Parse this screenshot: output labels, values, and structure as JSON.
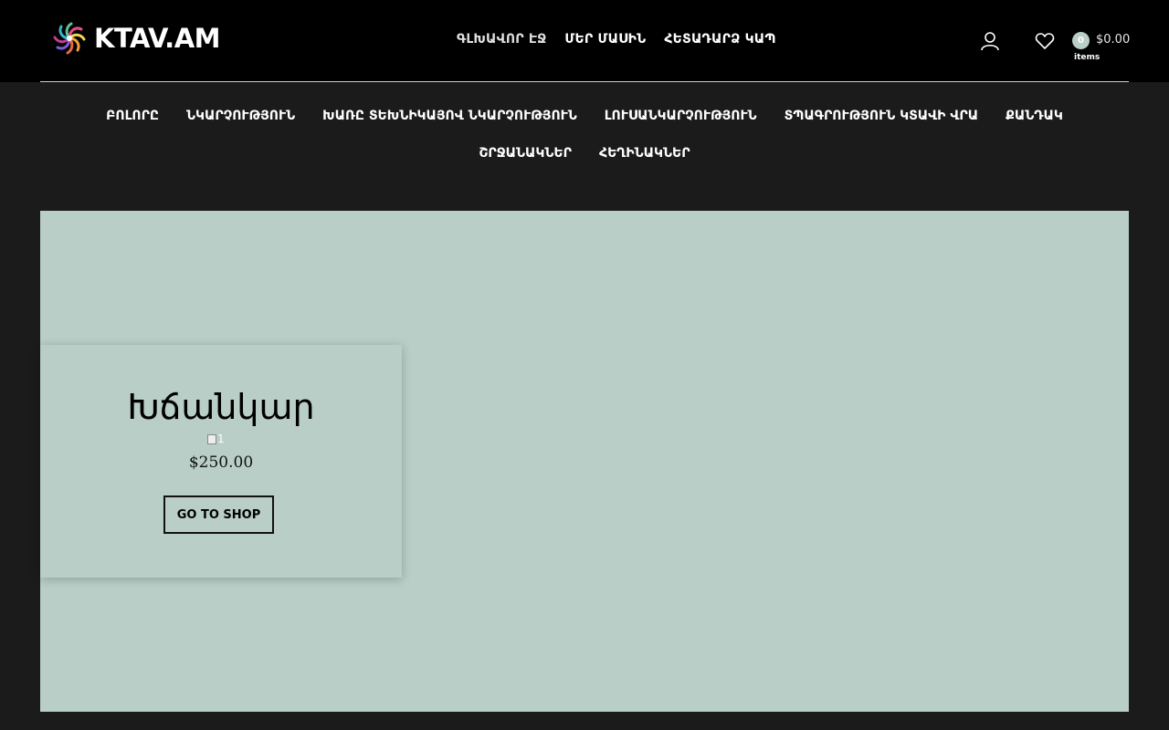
{
  "brand": {
    "name": "KTAV.AM"
  },
  "topnav": {
    "items": [
      {
        "label": "ԳԼԽԱՎՈՐ ԷՋ"
      },
      {
        "label": "ՄԵՐ ՄԱՍԻՆ"
      },
      {
        "label": "ՀԵՏԱԴԱՐՁ ԿԱՊ"
      }
    ]
  },
  "header": {
    "cart_count": "0",
    "cart_total": "$0.00",
    "cart_items_label": "items",
    "badge_color": "#b9cec6"
  },
  "catnav": {
    "items": [
      {
        "label": "ԲՈԼՈՐԸ"
      },
      {
        "label": "ՆԿԱՐՉՈՒԹՅՈՒՆ"
      },
      {
        "label": "ԽԱՌԸ ՏԵԽՆԻԿԱՅՈՎ ՆԿԱՐՉՈՒԹՅՈՒՆ"
      },
      {
        "label": "ԼՈՒՍԱՆԿԱՐՉՈՒԹՅՈՒՆ"
      },
      {
        "label": "ՏՊԱԳՐՈՒԹՅՈՒՆ ԿՏԱՎԻ ՎՐԱ"
      },
      {
        "label": "ՔԱՆԴԱԿ"
      },
      {
        "label": "ՇՐՋԱՆԱԿՆԵՐ"
      },
      {
        "label": "ՀԵՂԻՆԱԿՆԵՐ"
      }
    ]
  },
  "hero": {
    "background": "#b9cec6",
    "card": {
      "title": "Խճանկար",
      "image_alt": "1",
      "price": "$250.00",
      "button_label": "GO TO SHOP"
    }
  },
  "icons": [
    "ktav-logo-icon",
    "user-icon",
    "heart-icon"
  ]
}
